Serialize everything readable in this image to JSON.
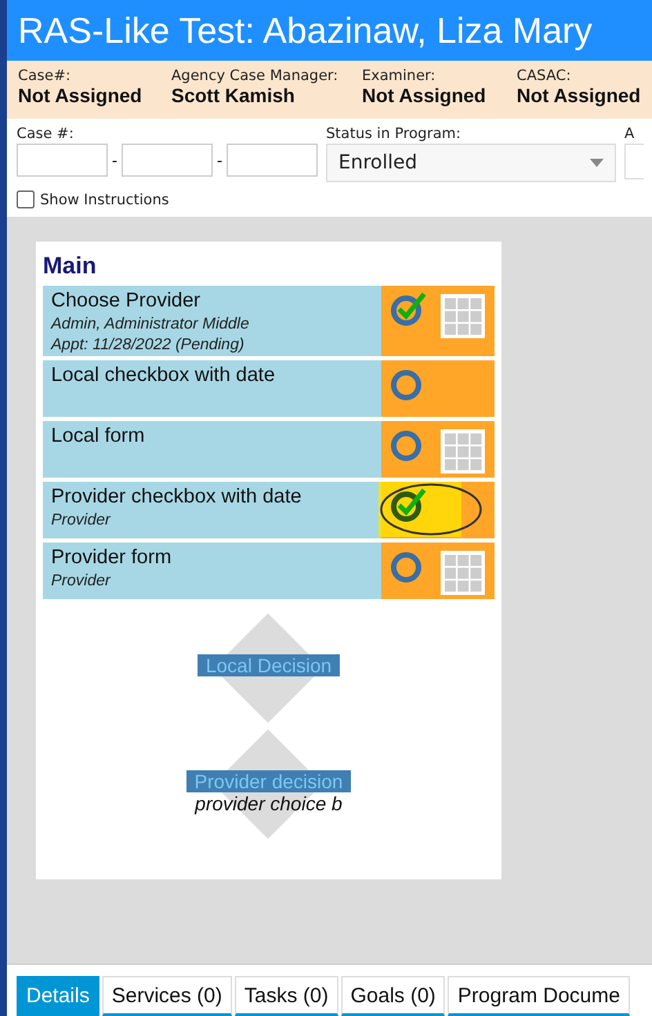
{
  "window": {
    "title": "RAS-Like Test: Abazinaw, Liza Mary"
  },
  "info": [
    {
      "label": "Case#:",
      "value": "Not Assigned"
    },
    {
      "label": "Agency Case Manager:",
      "value": "Scott Kamish"
    },
    {
      "label": "Examiner:",
      "value": "Not Assigned"
    },
    {
      "label": "CASAC:",
      "value": "Not Assigned"
    }
  ],
  "form": {
    "case_label": "Case #:",
    "separators": [
      "-",
      "-"
    ],
    "status_label": "Status in Program:",
    "status_value": "Enrolled",
    "cut_label": "A",
    "show_instructions": {
      "label": "Show Instructions",
      "checked": false
    }
  },
  "workflow": {
    "title": "Main",
    "steps": [
      {
        "kind": "form",
        "title": "Choose Provider",
        "details": [
          "Admin, Administrator Middle",
          "Appt: 11/28/2022 (Pending)"
        ],
        "done": true,
        "highlighted": false
      },
      {
        "kind": "checkbox",
        "title": "Local checkbox with date",
        "done": false,
        "highlighted": false
      },
      {
        "kind": "form",
        "title": "Local form",
        "done": false,
        "highlighted": false
      },
      {
        "kind": "checkbox",
        "title": "Provider checkbox with date",
        "details": [
          "Provider"
        ],
        "done": true,
        "highlighted": true
      },
      {
        "kind": "form",
        "title": "Provider form",
        "details": [
          "Provider"
        ],
        "done": false,
        "highlighted": false
      }
    ],
    "decisions": [
      {
        "label": "Local Decision"
      },
      {
        "label": "Provider decision",
        "choice": "provider choice b"
      }
    ]
  },
  "tabs": [
    {
      "label": "Details",
      "selected": true
    },
    {
      "label": "Services (0)",
      "selected": false
    },
    {
      "label": "Tasks (0)",
      "selected": false
    },
    {
      "label": "Goals (0)",
      "selected": false
    },
    {
      "label": "Program Docume",
      "selected": false
    }
  ]
}
